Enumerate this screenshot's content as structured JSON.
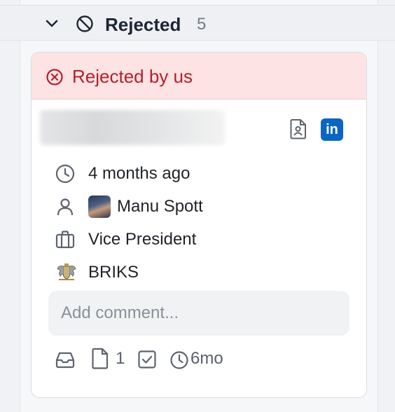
{
  "group": {
    "title": "Rejected",
    "count": "5",
    "chevron_icon": "chevron-down-icon",
    "status_icon": "ban-icon"
  },
  "card": {
    "banner": {
      "text": "Rejected by us",
      "icon": "x-circle-icon",
      "color": "#b2202e",
      "background": "#fde3e3"
    },
    "candidate_name": "",
    "resume_icon": "resume-icon",
    "linkedin_label": "in",
    "linkedin_color": "#0a66c2",
    "details": {
      "time": "4 months ago",
      "owner": "Manu Spott",
      "title": "Vice President",
      "company": "BRIKS"
    },
    "comment_placeholder": "Add comment...",
    "footer": {
      "attachments_count": "1",
      "age": "6mo"
    }
  }
}
